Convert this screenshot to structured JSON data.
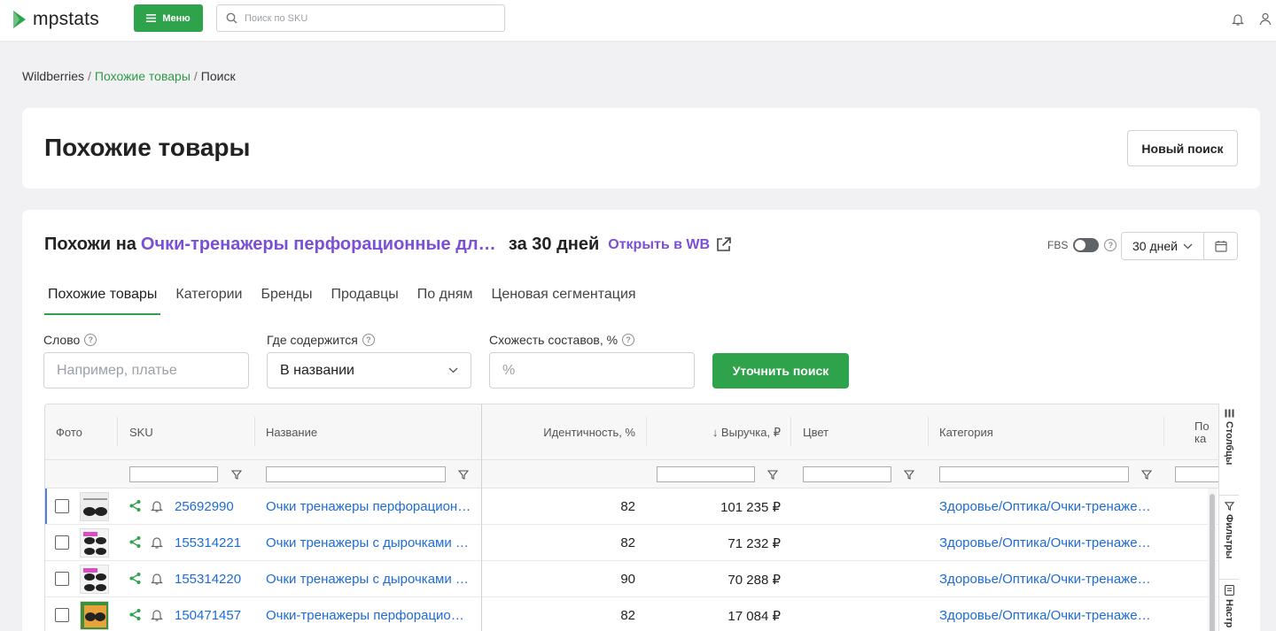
{
  "topbar": {
    "logo_text": "mpstats",
    "menu_label": "Меню",
    "search_placeholder": "Поиск по SKU",
    "icons": [
      "bell-icon",
      "user-icon"
    ]
  },
  "breadcrumb": {
    "root": "Wildberries",
    "middle": "Похожие товары",
    "current": "Поиск",
    "separator": "/"
  },
  "header": {
    "title": "Похожие товары",
    "new_search_label": "Новый поиск"
  },
  "similar": {
    "prefix": "Похожи на",
    "product": "Очки-тренажеры перфорационные для з...",
    "suffix": "за 30 дней",
    "open_wb": "Открыть в WB",
    "fbs_label": "FBS",
    "period": "30 дней"
  },
  "tabs": [
    {
      "label": "Похожие товары",
      "active": true
    },
    {
      "label": "Категории",
      "active": false
    },
    {
      "label": "Бренды",
      "active": false
    },
    {
      "label": "Продавцы",
      "active": false
    },
    {
      "label": "По дням",
      "active": false
    },
    {
      "label": "Ценовая сегментация",
      "active": false
    }
  ],
  "filters": {
    "word_label": "Слово",
    "word_placeholder": "Например, платье",
    "where_label": "Где содержится",
    "where_value": "В названии",
    "similarity_label": "Схожесть составов, %",
    "similarity_placeholder": "%",
    "refine_label": "Уточнить поиск"
  },
  "table": {
    "columns": [
      "Фото",
      "SKU",
      "Название",
      "Идентичность, %",
      "↓ Выручка, ₽",
      "Цвет",
      "Категория",
      "По ка"
    ],
    "rows": [
      {
        "sku": "25692990",
        "name": "Очки тренажеры перфорационные для зрения",
        "identity": "82",
        "revenue": "101 235 ₽",
        "color": "",
        "category": "Здоровье/Оптика/Очки-тренажеры"
      },
      {
        "sku": "155314221",
        "name": "Очки тренажеры с дырочками для зрения",
        "identity": "82",
        "revenue": "71 232 ₽",
        "color": "",
        "category": "Здоровье/Оптика/Очки-тренажеры"
      },
      {
        "sku": "155314220",
        "name": "Очки тренажеры с дырочками для зрения",
        "identity": "90",
        "revenue": "70 288 ₽",
        "color": "",
        "category": "Здоровье/Оптика/Очки-тренажеры"
      },
      {
        "sku": "150471457",
        "name": "Очки-тренажеры перфорационные для зрения",
        "identity": "82",
        "revenue": "17 084 ₽",
        "color": "",
        "category": "Здоровье/Оптика/Очки-тренажеры"
      }
    ]
  },
  "side_panel": {
    "columns": "Столбцы",
    "filters": "Фильтры",
    "settings": "Настр"
  },
  "colors": {
    "brand_green": "#2fa24c",
    "accent_purple": "#7b4fd6",
    "link_blue": "#1e6bd6"
  }
}
